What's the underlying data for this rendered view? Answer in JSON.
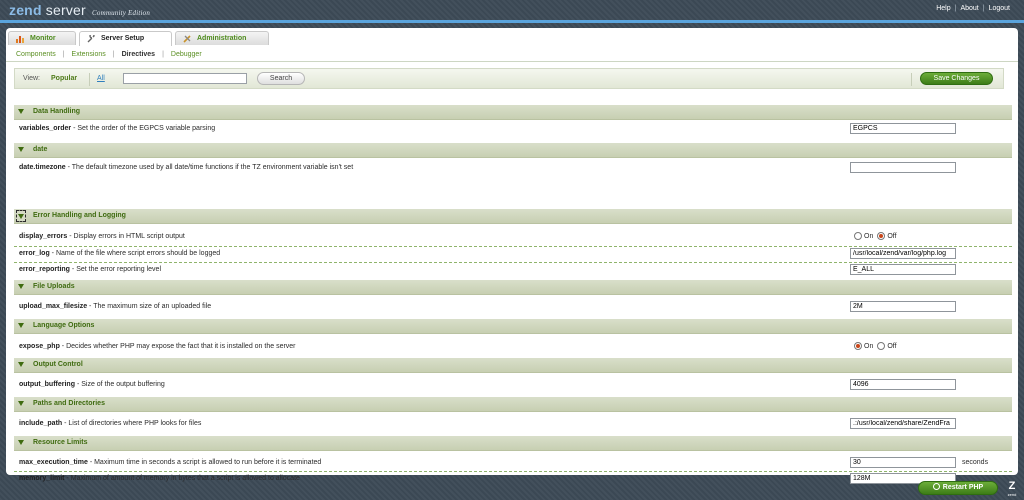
{
  "app": {
    "logo_brand": "zend",
    "logo_product": "server",
    "logo_edition": "Community Edition"
  },
  "top_links": [
    "Help",
    "About",
    "Logout"
  ],
  "tabs": [
    {
      "label": "Monitor"
    },
    {
      "label": "Server Setup"
    },
    {
      "label": "Administration"
    }
  ],
  "subnav": [
    "Components",
    "Extensions",
    "Directives",
    "Debugger"
  ],
  "filter": {
    "view_label": "View:",
    "popular": "Popular",
    "all": "All",
    "search_value": "",
    "search_label": "Search",
    "save_label": "Save Changes"
  },
  "sections": [
    {
      "title": "Data Handling",
      "rows": [
        {
          "name": "variables_order",
          "desc": " - Set the order of the EGPCS variable parsing",
          "type": "text",
          "value": "EGPCS"
        }
      ]
    },
    {
      "title": "date",
      "rows": [
        {
          "name": "date.timezone",
          "desc": " - The default timezone used by all date/time functions if the TZ environment variable isn't set",
          "type": "text",
          "value": ""
        }
      ]
    },
    {
      "title": "Error Handling and Logging",
      "rows": [
        {
          "name": "display_errors",
          "desc": " - Display errors in HTML script output",
          "type": "radio",
          "on_label": "On",
          "off_label": "Off",
          "selected": "Off"
        },
        {
          "name": "error_log",
          "desc": " - Name of the file where script errors should be logged",
          "type": "text",
          "value": "/usr/local/zend/var/log/php.log"
        },
        {
          "name": "error_reporting",
          "desc": " - Set the error reporting level",
          "type": "text",
          "value": "E_ALL"
        }
      ]
    },
    {
      "title": "File Uploads",
      "rows": [
        {
          "name": "upload_max_filesize",
          "desc": " - The maximum size of an uploaded file",
          "type": "text",
          "value": "2M"
        }
      ]
    },
    {
      "title": "Language Options",
      "rows": [
        {
          "name": "expose_php",
          "desc": " - Decides whether PHP may expose the fact that it is installed on the server",
          "type": "radio",
          "on_label": "On",
          "off_label": "Off",
          "selected": "On"
        }
      ]
    },
    {
      "title": "Output Control",
      "rows": [
        {
          "name": "output_buffering",
          "desc": " - Size of the output buffering",
          "type": "text",
          "value": "4096"
        }
      ]
    },
    {
      "title": "Paths and Directories",
      "rows": [
        {
          "name": "include_path",
          "desc": " - List of directories where PHP looks for files",
          "type": "text",
          "value": ".:/usr/local/zend/share/ZendFra"
        }
      ]
    },
    {
      "title": "Resource Limits",
      "rows": [
        {
          "name": "max_execution_time",
          "desc": " - Maximum time in seconds a script is allowed to run before it is terminated",
          "type": "text",
          "value": "30",
          "unit": "seconds"
        },
        {
          "name": "memory_limit",
          "desc": " - Maximum of amount of memory in bytes that a script is allowed to allocate",
          "type": "text",
          "value": "128M"
        }
      ]
    }
  ],
  "footer": {
    "restart_label": "Restart PHP",
    "logo_text": "Z",
    "logo_sub": "zend"
  },
  "colors": {
    "accent_green": "#4f8c1e",
    "header_blue": "#5aa4dd",
    "section_bar": "#d1d8bf"
  }
}
